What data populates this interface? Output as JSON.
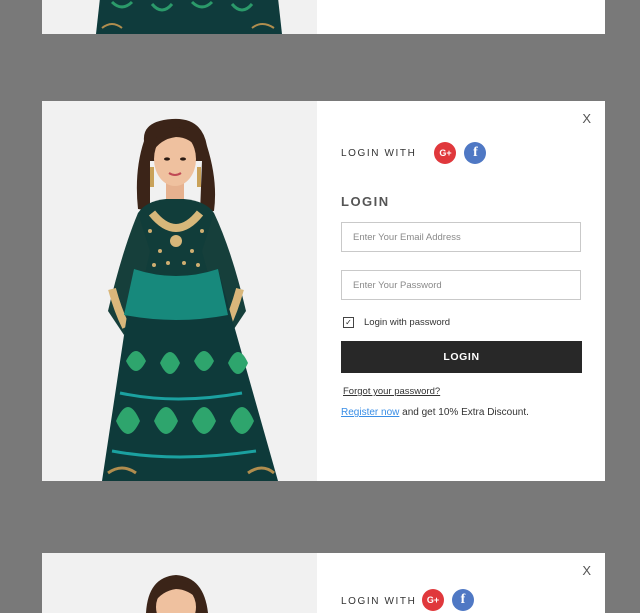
{
  "modal": {
    "close_label": "X",
    "login_with_label": "LOGIN WITH",
    "social": [
      {
        "name": "google-plus",
        "label": "G+",
        "color": "#e0383c"
      },
      {
        "name": "facebook",
        "label": "f",
        "color": "#4f78c4"
      }
    ],
    "login_title": "LOGIN",
    "email_placeholder": "Enter Your Email Address",
    "password_placeholder": "Enter Your Password",
    "remember_checked": true,
    "checkbox_label": "Login with password",
    "login_button_label": "LOGIN",
    "forgot_password_label": "Forgot your password?",
    "register_link_label": "Register now",
    "register_suffix": " and get 10% Extra Discount."
  },
  "colors": {
    "backdrop": "#797979",
    "button": "#282828",
    "link": "#3a8ee6"
  }
}
